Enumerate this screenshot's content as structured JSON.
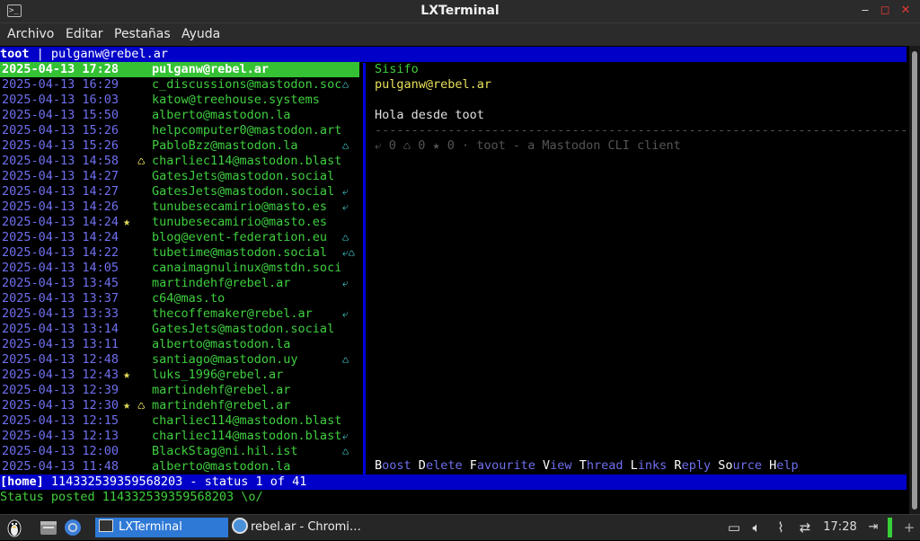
{
  "window": {
    "title": "LXTerminal",
    "icon": "terminal-icon",
    "controls": {
      "minimize": "‒",
      "maximize": "◻",
      "close": "✕"
    }
  },
  "menu": [
    "Archivo",
    "Editar",
    "Pestañas",
    "Ayuda"
  ],
  "header": {
    "app": "toot",
    "sep": " | ",
    "account": "pulganw@rebel.ar"
  },
  "timeline": [
    {
      "dt": "2025-04-13 17:28",
      "flags": "",
      "acct": "pulganw@rebel.ar",
      "ind": ""
    },
    {
      "dt": "2025-04-13 16:29",
      "flags": "",
      "acct": "c_discussions@mastodon.soc",
      "ind": "♺"
    },
    {
      "dt": "2025-04-13 16:03",
      "flags": "",
      "acct": "katow@treehouse.systems",
      "ind": ""
    },
    {
      "dt": "2025-04-13 15:50",
      "flags": "",
      "acct": "alberto@mastodon.la",
      "ind": ""
    },
    {
      "dt": "2025-04-13 15:26",
      "flags": "",
      "acct": "helpcomputer0@mastodon.art",
      "ind": ""
    },
    {
      "dt": "2025-04-13 15:26",
      "flags": "",
      "acct": "PabloBzz@mastodon.la",
      "ind": "♺"
    },
    {
      "dt": "2025-04-13 14:58",
      "flags": "  ♺",
      "acct": "charliec114@mastodon.blast",
      "ind": ""
    },
    {
      "dt": "2025-04-13 14:27",
      "flags": "",
      "acct": "GatesJets@mastodon.social",
      "ind": ""
    },
    {
      "dt": "2025-04-13 14:27",
      "flags": "",
      "acct": "GatesJets@mastodon.social",
      "ind": "⤶"
    },
    {
      "dt": "2025-04-13 14:26",
      "flags": "",
      "acct": "tunubesecamirio@masto.es",
      "ind": "⤶"
    },
    {
      "dt": "2025-04-13 14:24",
      "flags": "★",
      "acct": "tunubesecamirio@masto.es",
      "ind": ""
    },
    {
      "dt": "2025-04-13 14:24",
      "flags": "",
      "acct": "blog@event-federation.eu",
      "ind": "♺"
    },
    {
      "dt": "2025-04-13 14:22",
      "flags": "",
      "acct": "tubetime@mastodon.social",
      "ind": "⤶♺"
    },
    {
      "dt": "2025-04-13 14:05",
      "flags": "",
      "acct": "canaimagnulinux@mstdn.soci",
      "ind": ""
    },
    {
      "dt": "2025-04-13 13:45",
      "flags": "",
      "acct": "martindehf@rebel.ar",
      "ind": "⤶"
    },
    {
      "dt": "2025-04-13 13:37",
      "flags": "",
      "acct": "c64@mas.to",
      "ind": ""
    },
    {
      "dt": "2025-04-13 13:33",
      "flags": "",
      "acct": "thecoffemaker@rebel.ar",
      "ind": "⤶"
    },
    {
      "dt": "2025-04-13 13:14",
      "flags": "",
      "acct": "GatesJets@mastodon.social",
      "ind": ""
    },
    {
      "dt": "2025-04-13 13:11",
      "flags": "",
      "acct": "alberto@mastodon.la",
      "ind": ""
    },
    {
      "dt": "2025-04-13 12:48",
      "flags": "",
      "acct": "santiago@mastodon.uy",
      "ind": "♺"
    },
    {
      "dt": "2025-04-13 12:43",
      "flags": "★",
      "acct": "luks_1996@rebel.ar",
      "ind": ""
    },
    {
      "dt": "2025-04-13 12:39",
      "flags": "",
      "acct": "martindehf@rebel.ar",
      "ind": ""
    },
    {
      "dt": "2025-04-13 12:30",
      "flags": "★ ♺",
      "acct": "martindehf@rebel.ar",
      "ind": ""
    },
    {
      "dt": "2025-04-13 12:15",
      "flags": "",
      "acct": "charliec114@mastodon.blast",
      "ind": ""
    },
    {
      "dt": "2025-04-13 12:13",
      "flags": "",
      "acct": "charliec114@mastodon.blast",
      "ind": "⤶"
    },
    {
      "dt": "2025-04-13 12:00",
      "flags": "",
      "acct": "BlackStag@ni.hil.ist",
      "ind": "♺"
    },
    {
      "dt": "2025-04-13 11:48",
      "flags": "",
      "acct": "alberto@mastodon.la",
      "ind": ""
    }
  ],
  "detail": {
    "display_name": "Sisifo",
    "account": "pulganw@rebel.ar",
    "body": "Hola desde toot",
    "rule": "----------------------------------------------------------------------------------------------------",
    "meta": "⤶ 0 ♺ 0 ★ 0 · toot - a Mastodon CLI client"
  },
  "help_keys": [
    {
      "k": "B",
      "r": "oost"
    },
    {
      "k": "D",
      "r": "elete"
    },
    {
      "k": "F",
      "r": "avourite"
    },
    {
      "k": "V",
      "r": "iew"
    },
    {
      "k": "T",
      "r": "hread"
    },
    {
      "k": "L",
      "r": "inks"
    },
    {
      "k": "R",
      "r": "eply"
    },
    {
      "k": "So",
      "r": "urce",
      "pre": ""
    },
    {
      "k": "H",
      "r": "elp"
    }
  ],
  "footer": {
    "tag": "[home]",
    "text": " 114332539359568203 - status 1 of 41"
  },
  "status_line": "Status posted 114332539359568203 \\o/",
  "taskbar": {
    "tasks": [
      {
        "label": "LXTerminal",
        "active": true
      },
      {
        "label": "rebel.ar - Chromi…",
        "active": false
      }
    ],
    "clock": "17:28"
  }
}
